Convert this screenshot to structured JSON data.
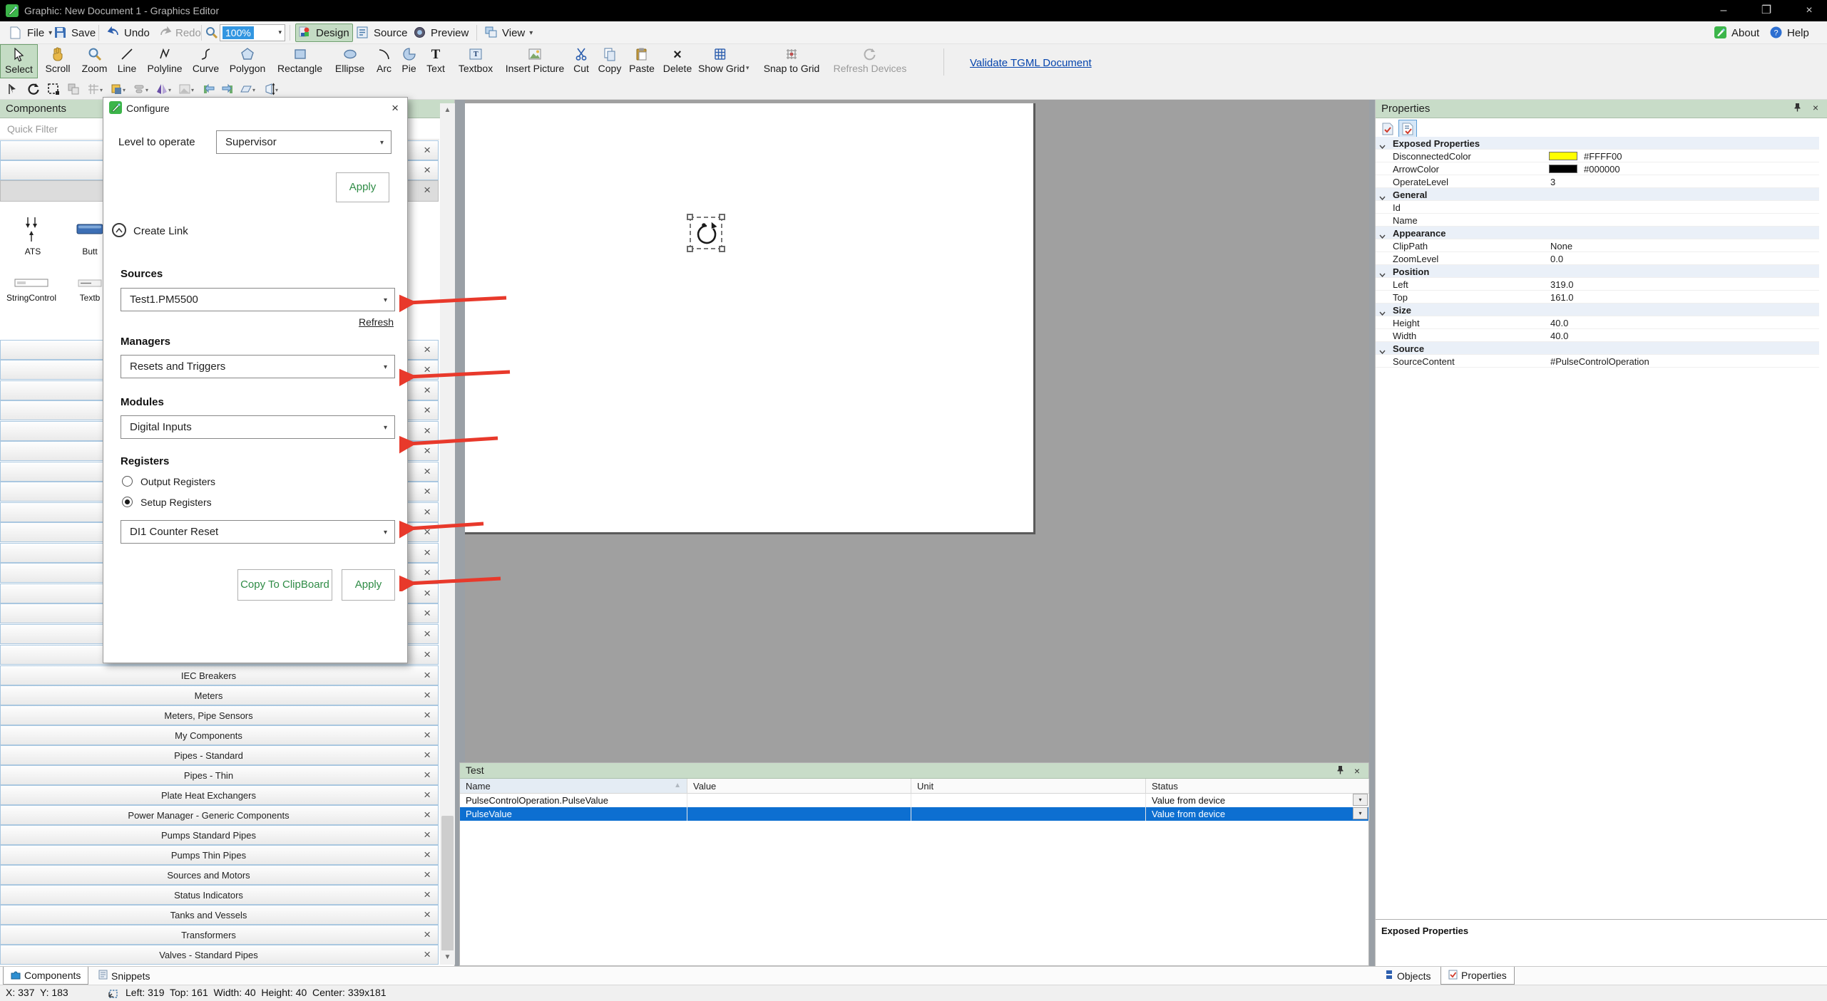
{
  "window": {
    "title": "Graphic: New Document 1 - Graphics Editor"
  },
  "menubar": {
    "file": "File",
    "save": "Save",
    "undo": "Undo",
    "redo": "Redo",
    "zoom_value": "100%",
    "design": "Design",
    "source": "Source",
    "preview": "Preview",
    "view": "View",
    "about": "About",
    "help": "Help"
  },
  "toolbar": {
    "items": [
      "Select",
      "Scroll",
      "Zoom",
      "Line",
      "Polyline",
      "Curve",
      "Polygon",
      "Rectangle",
      "Ellipse",
      "Arc",
      "Pie",
      "Text",
      "Textbox",
      "Insert Picture",
      "Cut",
      "Copy",
      "Paste",
      "Delete",
      "Show Grid",
      "Snap to Grid",
      "Refresh Devices"
    ],
    "validate_link": "Validate TGML Document"
  },
  "components": {
    "title": "Components",
    "quick_filter": "Quick Filter",
    "items": [
      "ATS",
      "Butt",
      "StringControl",
      "Textb"
    ],
    "categories": [
      "IEC Breakers",
      "Meters",
      "Meters, Pipe Sensors",
      "My Components",
      "Pipes - Standard",
      "Pipes - Thin",
      "Plate Heat Exchangers",
      "Power Manager - Generic Components",
      "Pumps Standard Pipes",
      "Pumps Thin Pipes",
      "Sources and Motors",
      "Status Indicators",
      "Tanks and Vessels",
      "Transformers",
      "Valves - Standard Pipes"
    ]
  },
  "dialog": {
    "title": "Configure",
    "level_label": "Level to operate",
    "level_value": "Supervisor",
    "apply_top": "Apply",
    "create_link": "Create Link",
    "sources_label": "Sources",
    "sources_value": "Test1.PM5500",
    "refresh": "Refresh",
    "managers_label": "Managers",
    "managers_value": "Resets and Triggers",
    "modules_label": "Modules",
    "modules_value": "Digital Inputs",
    "registers_label": "Registers",
    "radio_output": "Output Registers",
    "radio_setup": "Setup Registers",
    "registers_value": "DI1 Counter Reset",
    "copy_button": "Copy To ClipBoard",
    "apply_bottom": "Apply"
  },
  "properties": {
    "title": "Properties",
    "rows": [
      {
        "kind": "group",
        "label": "Exposed Properties"
      },
      {
        "kind": "color",
        "label": "DisconnectedColor",
        "value": "#FFFF00",
        "swatch": "background:#FFFF00"
      },
      {
        "kind": "color",
        "label": "ArrowColor",
        "value": "#000000",
        "swatch": "background:#000000"
      },
      {
        "kind": "prop",
        "label": "OperateLevel",
        "value": "3"
      },
      {
        "kind": "group",
        "label": "General"
      },
      {
        "kind": "prop",
        "label": "Id",
        "value": ""
      },
      {
        "kind": "prop",
        "label": "Name",
        "value": ""
      },
      {
        "kind": "group",
        "label": "Appearance"
      },
      {
        "kind": "prop",
        "label": "ClipPath",
        "value": "None"
      },
      {
        "kind": "prop",
        "label": "ZoomLevel",
        "value": "0.0"
      },
      {
        "kind": "group",
        "label": "Position"
      },
      {
        "kind": "prop",
        "label": "Left",
        "value": "319.0"
      },
      {
        "kind": "prop",
        "label": "Top",
        "value": "161.0"
      },
      {
        "kind": "group",
        "label": "Size"
      },
      {
        "kind": "prop",
        "label": "Height",
        "value": "40.0"
      },
      {
        "kind": "prop",
        "label": "Width",
        "value": "40.0"
      },
      {
        "kind": "group",
        "label": "Source"
      },
      {
        "kind": "prop",
        "label": "SourceContent",
        "value": "#PulseControlOperation"
      }
    ],
    "footer": "Exposed Properties",
    "tabs": {
      "objects": "Objects",
      "properties": "Properties"
    }
  },
  "test": {
    "title": "Test",
    "columns": [
      "Name",
      "Value",
      "Unit",
      "Status"
    ],
    "rows": [
      {
        "name": "PulseControlOperation.PulseValue",
        "value": "",
        "unit": "",
        "status": "Value from device"
      },
      {
        "name": "PulseValue",
        "value": "",
        "unit": "",
        "status": "Value from device"
      }
    ]
  },
  "statusbar": {
    "coords": "X: 337  Y: 183",
    "geometry": "Left: 319  Top: 161  Width: 40  Height: 40  Center: 339x181"
  },
  "bottom_tabs": {
    "components": "Components",
    "snippets": "Snippets"
  },
  "colors": {
    "accent_green": "#c4dcc4",
    "panel_header_green": "#c8dcc8",
    "selection_blue": "#0d6fd1",
    "arrow_red": "#e8392b",
    "link_blue": "#0645ad"
  }
}
